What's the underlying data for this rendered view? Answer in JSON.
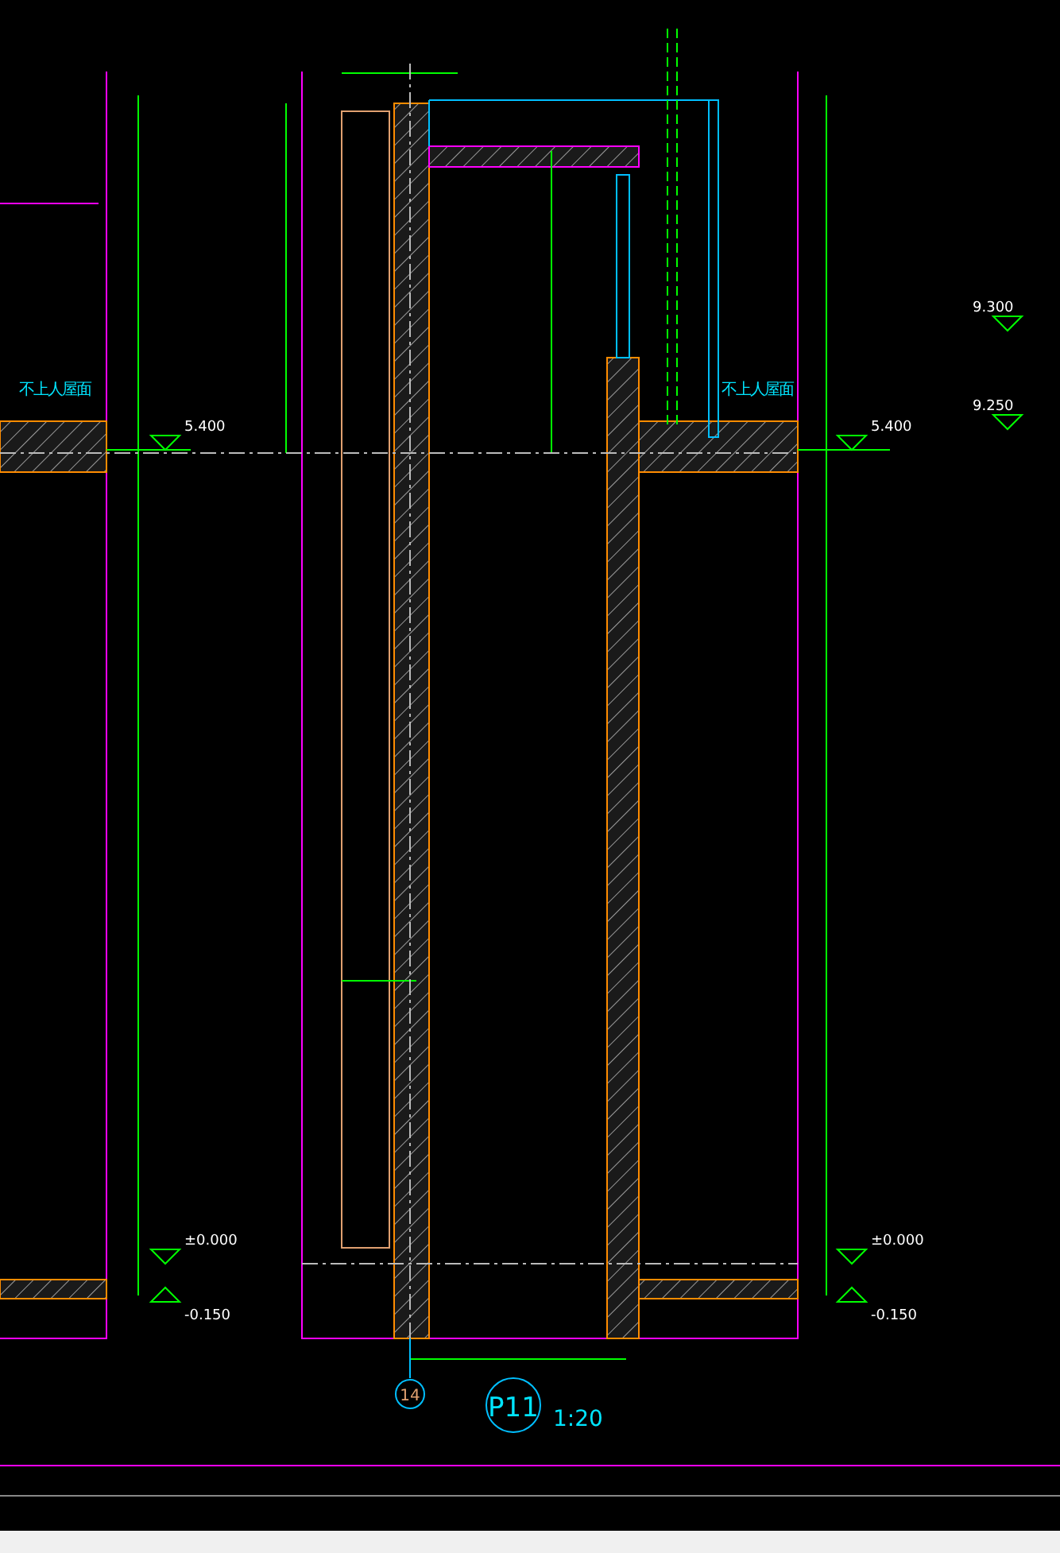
{
  "drawing": {
    "roof_labels": [
      {
        "text": "不上人屋面"
      },
      {
        "text": "不上人屋面"
      }
    ],
    "elevations": [
      {
        "value": "5.400"
      },
      {
        "value": "±0.000"
      },
      {
        "value": "-0.150"
      },
      {
        "value": "5.400"
      },
      {
        "value": "±0.000"
      },
      {
        "value": "-0.150"
      },
      {
        "value": "9.300"
      },
      {
        "value": "9.250"
      }
    ],
    "axis_bubble": "14",
    "detail_title": {
      "number": "P11",
      "scale": "1:20"
    }
  }
}
